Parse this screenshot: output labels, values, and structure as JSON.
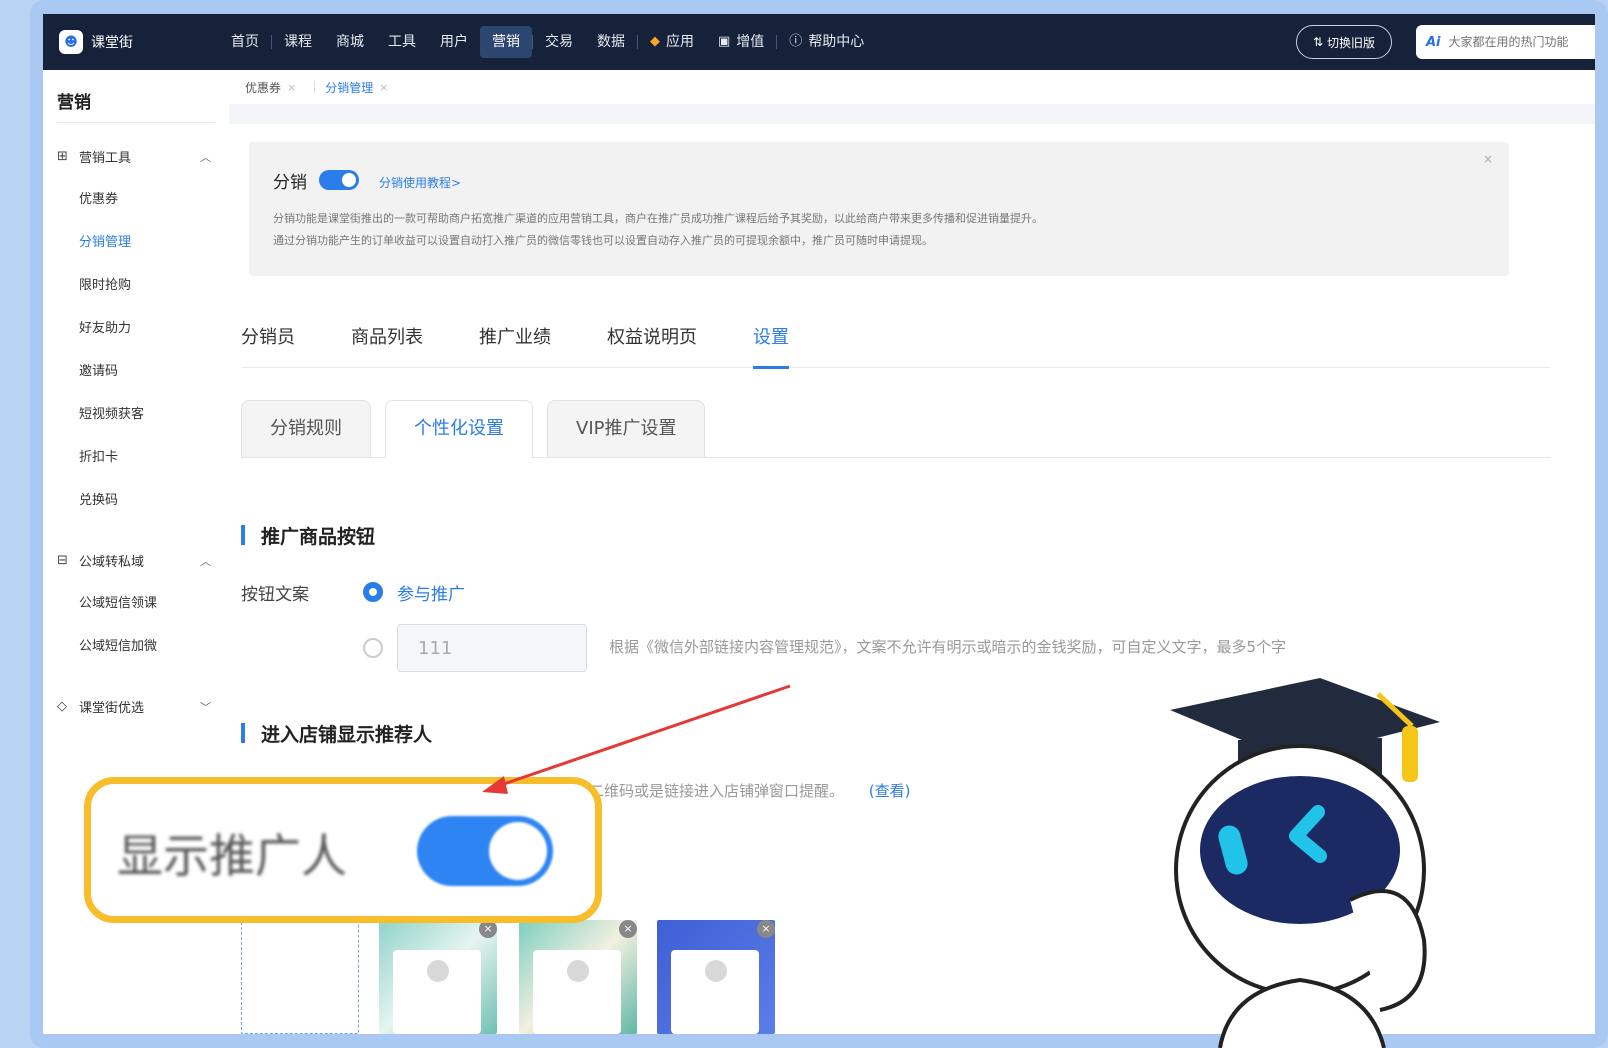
{
  "app": {
    "brand": "课堂街"
  },
  "topnav": {
    "items": [
      "首页",
      "课程",
      "商城",
      "工具",
      "用户",
      "营销",
      "交易",
      "数据"
    ],
    "active": "营销",
    "extra": [
      {
        "icon": "cube-icon",
        "label": "应用"
      },
      {
        "icon": "chart-icon",
        "label": "增值"
      },
      {
        "icon": "help-circle-icon",
        "label": "帮助中心"
      }
    ],
    "switch_old": "切换旧版",
    "ai_badge": "Ai",
    "search_placeholder": "大家都在用的热门功能"
  },
  "sidebar": {
    "title": "营销",
    "groups": [
      {
        "label": "营销工具",
        "icon": "gift-icon",
        "expanded": true,
        "items": [
          "优惠券",
          "分销管理",
          "限时抢购",
          "好友助力",
          "邀请码",
          "短视频获客",
          "折扣卡",
          "兑换码"
        ]
      },
      {
        "label": "公域转私域",
        "icon": "transfer-icon",
        "expanded": true,
        "items": [
          "公域短信领课",
          "公域短信加微"
        ]
      },
      {
        "label": "课堂街优选",
        "icon": "diamond-icon",
        "expanded": false,
        "items": []
      }
    ],
    "active_item": "分销管理"
  },
  "breadcrumbs": [
    {
      "label": "优惠券",
      "active": false
    },
    {
      "label": "分销管理",
      "active": true
    }
  ],
  "intro": {
    "title": "分销",
    "enabled": true,
    "link": "分销使用教程>",
    "desc1": "分销功能是课堂街推出的一款可帮助商户拓宽推广渠道的应用营销工具，商户在推广员成功推广课程后给予其奖励，以此给商户带来更多传播和促进销量提升。",
    "desc2": "通过分销功能产生的订单收益可以设置自动打入推广员的微信零钱也可以设置自动存入推广员的可提现余额中，推广员可随时申请提现。"
  },
  "tabs": [
    "分销员",
    "商品列表",
    "推广业绩",
    "权益说明页",
    "设置"
  ],
  "active_tab": "设置",
  "subtabs": [
    "分销规则",
    "个性化设置",
    "VIP推广设置"
  ],
  "active_subtab": "个性化设置",
  "section1": {
    "title": "推广商品按钮",
    "label": "按钮文案",
    "option1": "参与推广",
    "custom_value": "111",
    "hint": "根据《微信外部链接内容管理规范》，文案不允许有明示或暗示的金钱奖励，可自定义文字，最多5个字"
  },
  "section2": {
    "title": "进入店铺显示推荐人",
    "hint_visible": "二维码或是链接进入店铺弹窗口提醒。",
    "view_link": "(查看)"
  },
  "callout": {
    "label": "显示推广人",
    "enabled": true
  },
  "colors": {
    "accent": "#2b7de9",
    "nav_bg": "#16213a",
    "callout_border": "#f7bd2b",
    "arrow": "#e53935"
  }
}
